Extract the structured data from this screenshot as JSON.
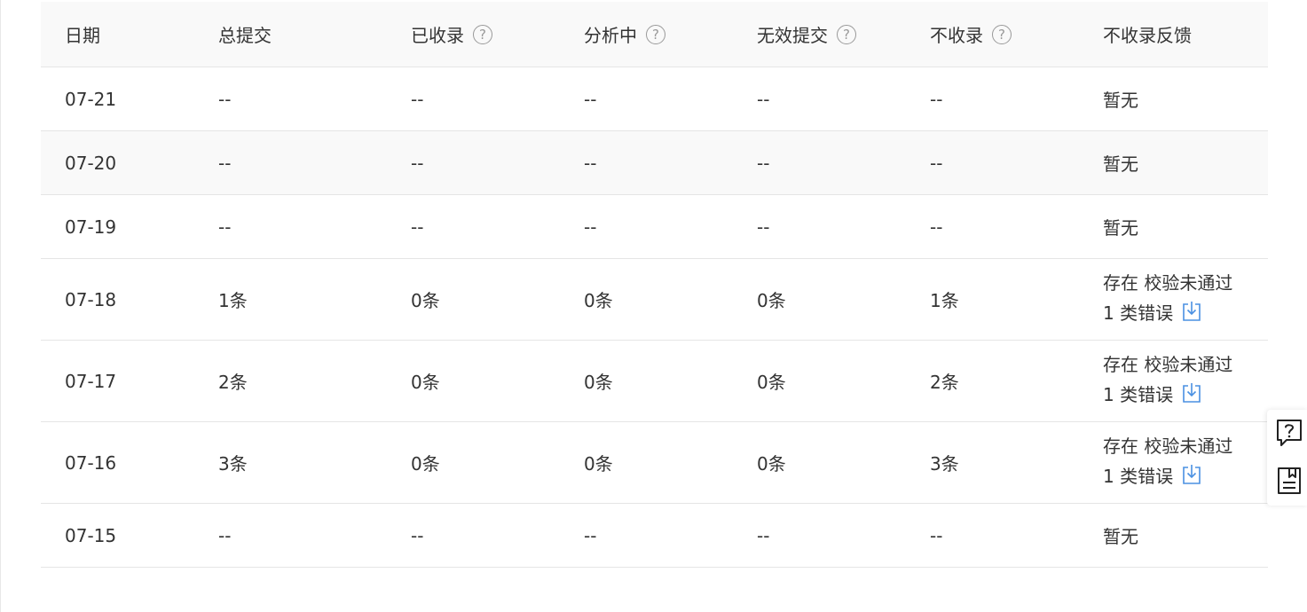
{
  "table": {
    "columns": [
      {
        "label": "日期",
        "help": false
      },
      {
        "label": "总提交",
        "help": false
      },
      {
        "label": "已收录",
        "help": true
      },
      {
        "label": "分析中",
        "help": true
      },
      {
        "label": "无效提交",
        "help": true
      },
      {
        "label": "不收录",
        "help": true
      },
      {
        "label": "不收录反馈",
        "help": false
      }
    ],
    "help_glyph": "?",
    "rows": [
      {
        "date": "07-21",
        "total": "--",
        "indexed": "--",
        "analyzing": "--",
        "invalid": "--",
        "not_indexed": "--",
        "feedback": "暂无"
      },
      {
        "date": "07-20",
        "total": "--",
        "indexed": "--",
        "analyzing": "--",
        "invalid": "--",
        "not_indexed": "--",
        "feedback": "暂无"
      },
      {
        "date": "07-19",
        "total": "--",
        "indexed": "--",
        "analyzing": "--",
        "invalid": "--",
        "not_indexed": "--",
        "feedback": "暂无"
      },
      {
        "date": "07-18",
        "total": "1条",
        "indexed": "0条",
        "analyzing": "0条",
        "invalid": "0条",
        "not_indexed": "1条",
        "feedback_line1": "存在 校验未通过",
        "feedback_line2": "1 类错误"
      },
      {
        "date": "07-17",
        "total": "2条",
        "indexed": "0条",
        "analyzing": "0条",
        "invalid": "0条",
        "not_indexed": "2条",
        "feedback_line1": "存在 校验未通过",
        "feedback_line2": "1 类错误"
      },
      {
        "date": "07-16",
        "total": "3条",
        "indexed": "0条",
        "analyzing": "0条",
        "invalid": "0条",
        "not_indexed": "3条",
        "feedback_line1": "存在 校验未通过",
        "feedback_line2": "1 类错误"
      },
      {
        "date": "07-15",
        "total": "--",
        "indexed": "--",
        "analyzing": "--",
        "invalid": "--",
        "not_indexed": "--",
        "feedback": "暂无"
      }
    ]
  },
  "colors": {
    "accent": "#4a90e2",
    "header_bg": "#f9f9f9",
    "border": "#e5e5e5"
  },
  "float_panel": {
    "icons": [
      "help-chat-icon",
      "document-icon"
    ]
  }
}
